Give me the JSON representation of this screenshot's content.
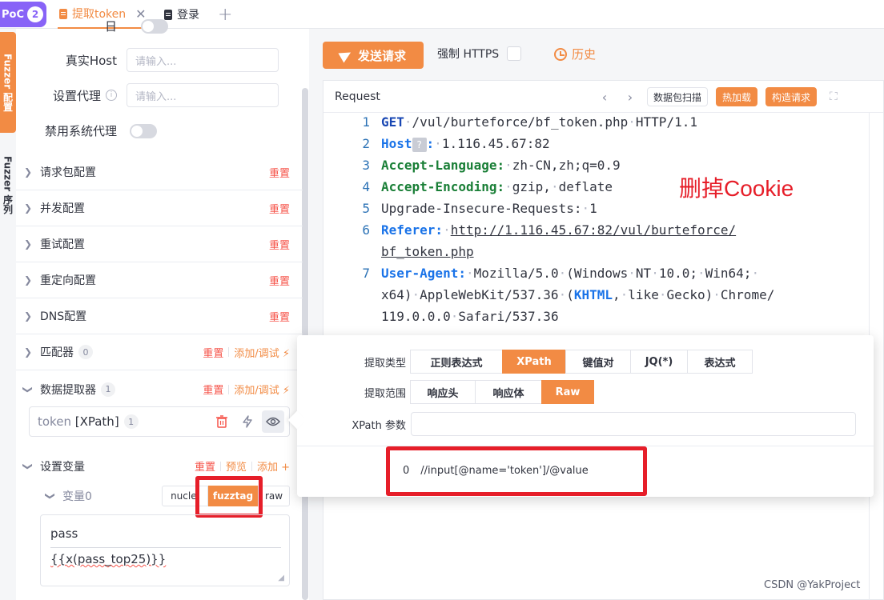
{
  "tabs": {
    "poc_label": "PoC",
    "poc_count": "2",
    "active_label": "提取token",
    "login_label": "登录",
    "add_symbol": "+",
    "close_symbol": "✕"
  },
  "vertical_tabs": {
    "fuzzer_label": "Fuzzer 配置",
    "sequence_label": "Fuzzer 序列"
  },
  "config": {
    "top_partial_label": "日",
    "real_host_label": "真实Host",
    "real_host_placeholder": "请输入...",
    "proxy_label": "设置代理",
    "proxy_placeholder": "请输入...",
    "disable_sys_proxy_label": "禁用系统代理",
    "sections": [
      {
        "title": "请求包配置",
        "reset": "重置"
      },
      {
        "title": "并发配置",
        "reset": "重置"
      },
      {
        "title": "重试配置",
        "reset": "重置"
      },
      {
        "title": "重定向配置",
        "reset": "重置"
      },
      {
        "title": "DNS配置",
        "reset": "重置"
      }
    ],
    "matcher": {
      "title": "匹配器",
      "count": "0",
      "reset": "重置",
      "add": "添加/调试 ⚡"
    },
    "extractor": {
      "title": "数据提取器",
      "count": "1",
      "reset": "重置",
      "add": "添加/调试 ⚡"
    },
    "extractor_item": {
      "name": "token",
      "type": "[XPath]",
      "count": "1"
    },
    "variables": {
      "title": "设置变量",
      "reset": "重置",
      "preview": "预览",
      "add": "添加 +"
    },
    "variable0": {
      "label": "变量0",
      "options": [
        "nuclei",
        "fuzztag",
        "raw"
      ],
      "selected": "fuzztag",
      "key": "pass",
      "value": "{{x(pass_top25)}}"
    }
  },
  "toolbar": {
    "send_label": "发送请求",
    "https_label": "强制 HTTPS",
    "history_label": "历史"
  },
  "request": {
    "title": "Request",
    "scan_label": "数据包扫描",
    "hot_load_label": "热加载",
    "build_label": "构造请求",
    "lines": [
      {
        "n": "1",
        "parts": [
          [
            "kw-get",
            "GET"
          ],
          [
            "dot",
            "·"
          ],
          [
            "t",
            "/vul/burteforce/bf_token.php"
          ],
          [
            "dot",
            "·"
          ],
          [
            "t",
            "HTTP/1.1"
          ]
        ]
      },
      {
        "n": "2",
        "parts": [
          [
            "kw-blue",
            "Host"
          ],
          [
            "q",
            "?"
          ],
          [
            "kw-blue",
            ":"
          ],
          [
            "dot",
            "·"
          ],
          [
            "t",
            "1.116.45.67:82"
          ]
        ]
      },
      {
        "n": "3",
        "parts": [
          [
            "kw-green",
            "Accept-Language:"
          ],
          [
            "dot",
            "·"
          ],
          [
            "t",
            "zh-CN,zh;q=0.9"
          ]
        ]
      },
      {
        "n": "4",
        "parts": [
          [
            "kw-green",
            "Accept-Encoding:"
          ],
          [
            "dot",
            "·"
          ],
          [
            "t",
            "gzip,"
          ],
          [
            "dot",
            "·"
          ],
          [
            "t",
            "deflate"
          ]
        ]
      },
      {
        "n": "5",
        "parts": [
          [
            "t",
            "Upgrade-Insecure-Requests:"
          ],
          [
            "dot",
            "·"
          ],
          [
            "t",
            "1"
          ]
        ]
      },
      {
        "n": "6",
        "parts": [
          [
            "kw-blue",
            "Referer:"
          ],
          [
            "dot",
            "·"
          ],
          [
            "u",
            "http://1.116.45.67:82/vul/burteforce/"
          ]
        ]
      },
      {
        "n": "",
        "parts": [
          [
            "u",
            "bf_token.php"
          ]
        ]
      },
      {
        "n": "7",
        "parts": [
          [
            "kw-blue",
            "User-Agent:"
          ],
          [
            "dot",
            "·"
          ],
          [
            "t",
            "Mozilla/5.0"
          ],
          [
            "dot",
            "·"
          ],
          [
            "t",
            "(Windows"
          ],
          [
            "dot",
            "·"
          ],
          [
            "t",
            "NT"
          ],
          [
            "dot",
            "·"
          ],
          [
            "t",
            "10.0;"
          ],
          [
            "dot",
            "·"
          ],
          [
            "t",
            "Win64;"
          ],
          [
            "dot",
            "·"
          ]
        ]
      },
      {
        "n": "",
        "parts": [
          [
            "t",
            "x64)"
          ],
          [
            "dot",
            "·"
          ],
          [
            "t",
            "AppleWebKit/537.36"
          ],
          [
            "dot",
            "·"
          ],
          [
            "t",
            "("
          ],
          [
            "kw-blue",
            "KHTML"
          ],
          [
            "t",
            ","
          ],
          [
            "dot",
            "·"
          ],
          [
            "t",
            "like"
          ],
          [
            "dot",
            "·"
          ],
          [
            "t",
            "Gecko)"
          ],
          [
            "dot",
            "·"
          ],
          [
            "t",
            "Chrome/"
          ]
        ]
      },
      {
        "n": "",
        "parts": [
          [
            "t",
            "119.0.0.0"
          ],
          [
            "dot",
            "·"
          ],
          [
            "t",
            "Safari/537.36"
          ]
        ]
      }
    ],
    "annotation": "删掉Cookie"
  },
  "popover": {
    "type_label": "提取类型",
    "type_options": [
      "正则表达式",
      "XPath",
      "键值对",
      "JQ(*)",
      "表达式"
    ],
    "type_selected": "XPath",
    "scope_label": "提取范围",
    "scope_options": [
      "响应头",
      "响应体",
      "Raw"
    ],
    "scope_selected": "Raw",
    "param_label": "XPath 参数",
    "item_index": "0",
    "item_value": "//input[@name='token']/@value"
  },
  "watermark": "CSDN @YakProject",
  "colors": {
    "accent": "#f28b44",
    "danger": "#f6544a",
    "poc": "#8863f7",
    "annotation": "#e61e29"
  }
}
